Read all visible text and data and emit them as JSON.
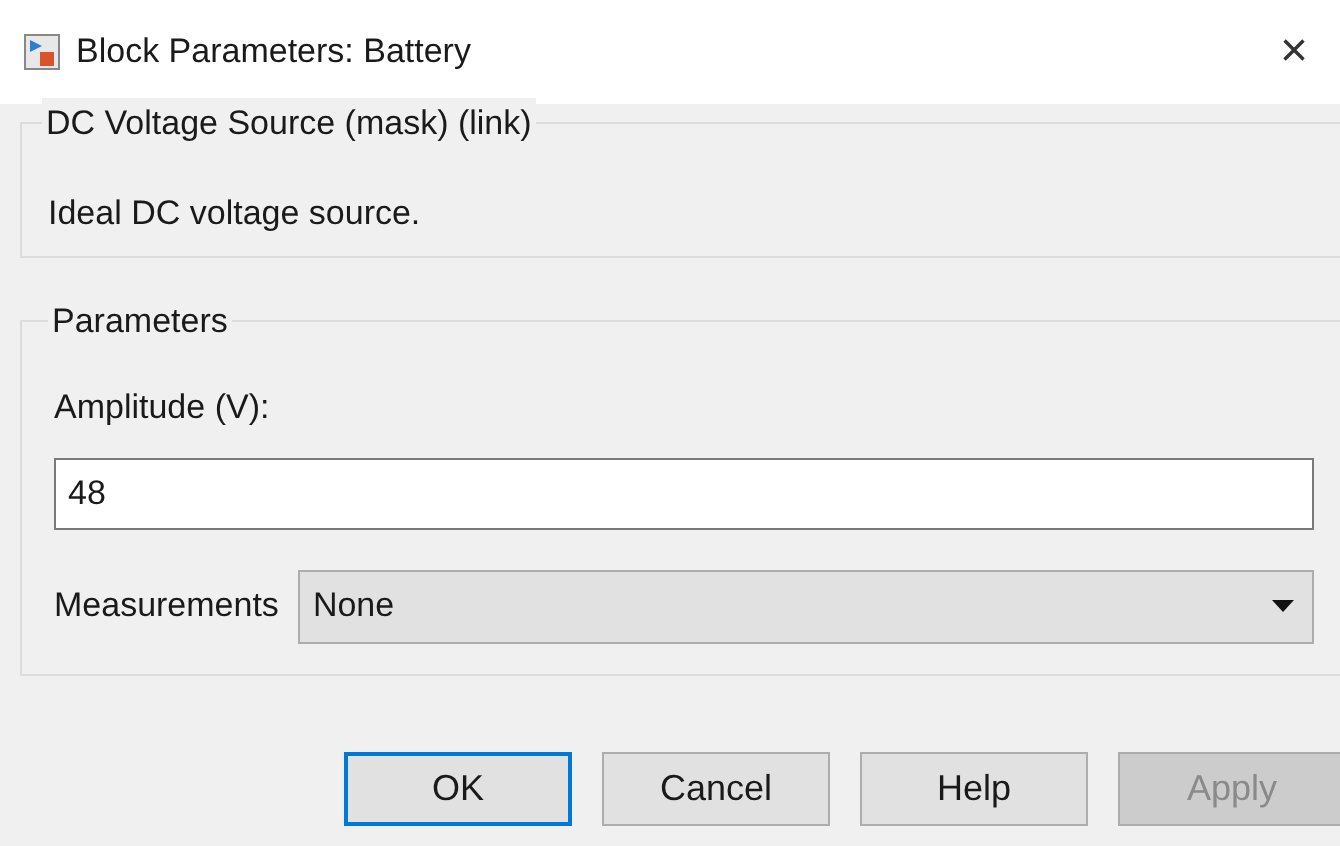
{
  "window": {
    "title": "Block Parameters: Battery",
    "close": "×"
  },
  "mask_group": {
    "title": "DC Voltage Source (mask) (link)",
    "description": "Ideal DC voltage source."
  },
  "parameters_group": {
    "title": "Parameters",
    "amplitude": {
      "label": "Amplitude (V):",
      "value": "48"
    },
    "measurements": {
      "label": "Measurements",
      "value": "None"
    }
  },
  "buttons": [
    {
      "label": "OK",
      "default": true,
      "disabled": false
    },
    {
      "label": "Cancel",
      "default": false,
      "disabled": false
    },
    {
      "label": "Help",
      "default": false,
      "disabled": false
    },
    {
      "label": "Apply",
      "default": false,
      "disabled": true
    }
  ]
}
